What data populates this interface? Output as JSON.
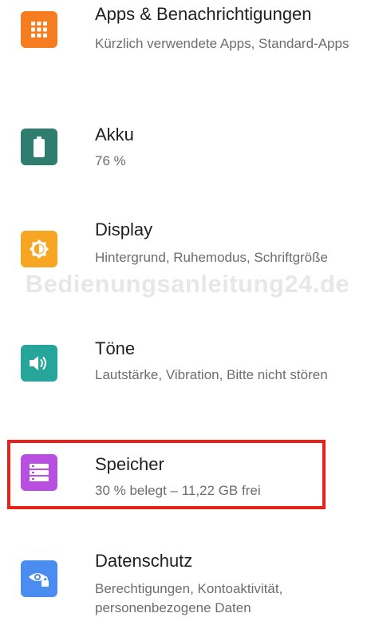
{
  "settings": [
    {
      "key": "apps",
      "title": "Apps & Benachrichtigungen",
      "summary": "Kürzlich verwendete Apps, Standard-Apps",
      "icon": "apps-grid-icon",
      "color": "#F57C1F"
    },
    {
      "key": "battery",
      "title": "Akku",
      "summary": "76 %",
      "icon": "battery-icon",
      "color": "#2E7D6F"
    },
    {
      "key": "display",
      "title": "Display",
      "summary": "Hintergrund, Ruhemodus, Schriftgröße",
      "icon": "brightness-icon",
      "color": "#F6A623"
    },
    {
      "key": "sound",
      "title": "Töne",
      "summary": "Lautstärke, Vibration, Bitte nicht stören",
      "icon": "volume-icon",
      "color": "#26A69A"
    },
    {
      "key": "storage",
      "title": "Speicher",
      "summary": "30 % belegt – 11,22 GB frei",
      "icon": "storage-icon",
      "color": "#B84FE0"
    },
    {
      "key": "privacy",
      "title": "Datenschutz",
      "summary": "Berechtigungen, Kontoaktivität, personenbezogene Daten",
      "icon": "privacy-eye-lock-icon",
      "color": "#4A8CF0"
    }
  ],
  "highlight": {
    "target": "Speicher",
    "color": "#E8221A"
  },
  "watermark": "Bedienungsanleitung24.de"
}
